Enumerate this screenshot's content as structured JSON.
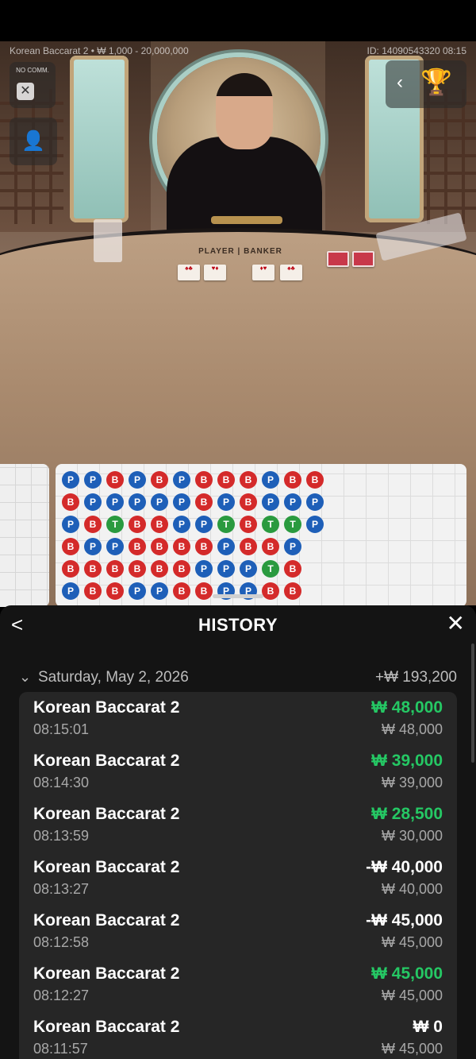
{
  "table_info": {
    "left": "Korean Baccarat 2 • ₩ 1,000 - 20,000,000",
    "right": "ID: 14090543320 08:15",
    "no_comm": "NO COMM.",
    "layout_label": "PLAYER | BANKER"
  },
  "icons": {
    "close_small": "✕",
    "camera": "👤",
    "chevron_left": "‹",
    "trophy": "🏆"
  },
  "colors": {
    "player": "#1e5fb8",
    "banker": "#d42a2a",
    "tie": "#2a9a3f",
    "win": "#25c864"
  },
  "bead_road": [
    [
      "P",
      "P",
      "B",
      "P",
      "B",
      "P",
      "B",
      "B",
      "B",
      "P",
      "B",
      "B"
    ],
    [
      "B",
      "P",
      "P",
      "P",
      "P",
      "P",
      "B",
      "P",
      "B",
      "P",
      "P",
      "P"
    ],
    [
      "P",
      "B",
      "T",
      "B",
      "B",
      "P",
      "P",
      "T",
      "B",
      "T",
      "T",
      "P"
    ],
    [
      "B",
      "P",
      "P",
      "B",
      "B",
      "B",
      "B",
      "P",
      "B",
      "B",
      "P",
      ""
    ],
    [
      "B",
      "B",
      "B",
      "B",
      "B",
      "B",
      "P",
      "P",
      "P",
      "T",
      "B",
      ""
    ],
    [
      "P",
      "B",
      "B",
      "P",
      "P",
      "B",
      "B",
      "P",
      "P",
      "B",
      "B",
      ""
    ]
  ],
  "history": {
    "back": "<",
    "title": "HISTORY",
    "close": "✕",
    "date_label": "Saturday, May 2, 2026",
    "date_total": "+₩ 193,200",
    "rows": [
      {
        "name": "Korean Baccarat 2",
        "time": "08:15:01",
        "result": "₩ 48,000",
        "stake": "₩ 48,000",
        "kind": "win"
      },
      {
        "name": "Korean Baccarat 2",
        "time": "08:14:30",
        "result": "₩ 39,000",
        "stake": "₩ 39,000",
        "kind": "win"
      },
      {
        "name": "Korean Baccarat 2",
        "time": "08:13:59",
        "result": "₩ 28,500",
        "stake": "₩ 30,000",
        "kind": "win"
      },
      {
        "name": "Korean Baccarat 2",
        "time": "08:13:27",
        "result": "-₩ 40,000",
        "stake": "₩ 40,000",
        "kind": "lose"
      },
      {
        "name": "Korean Baccarat 2",
        "time": "08:12:58",
        "result": "-₩ 45,000",
        "stake": "₩ 45,000",
        "kind": "lose"
      },
      {
        "name": "Korean Baccarat 2",
        "time": "08:12:27",
        "result": "₩ 45,000",
        "stake": "₩ 45,000",
        "kind": "win"
      },
      {
        "name": "Korean Baccarat 2",
        "time": "08:11:57",
        "result": "₩ 0",
        "stake": "₩ 45,000",
        "kind": "zero"
      }
    ]
  }
}
